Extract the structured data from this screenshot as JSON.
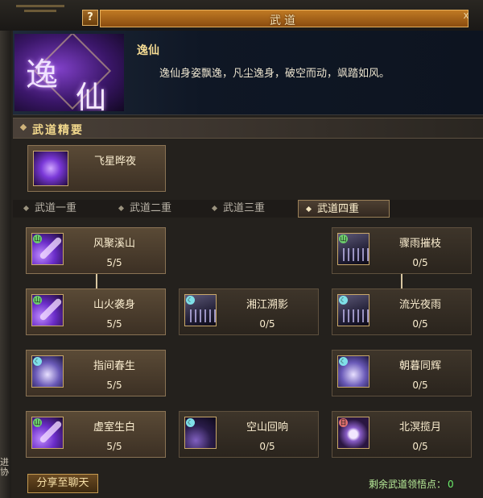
{
  "window": {
    "title": "武道",
    "help_label": "?",
    "close_label": "x"
  },
  "hero": {
    "emblem_char1": "逸",
    "emblem_char2": "仙",
    "name": "逸仙",
    "description": "逸仙身姿飘逸，凡尘逸身，破空而动，飒踏如风。"
  },
  "section": {
    "title": "武道精要"
  },
  "core_skill": {
    "name": "飞星晔夜"
  },
  "tabs": [
    {
      "label": "武道一重"
    },
    {
      "label": "武道二重"
    },
    {
      "label": "武道三重"
    },
    {
      "label": "武道四重",
      "active": true
    }
  ],
  "skills": [
    {
      "name": "风聚溪山",
      "count": "5/5",
      "icon": "purple-swipe-icon"
    },
    {
      "name": "山火袭身",
      "count": "5/5",
      "icon": "purple-swipe-icon"
    },
    {
      "name": "湘江溯影",
      "count": "0/5",
      "icon": "silver-streak-icon"
    },
    {
      "name": "流光夜雨",
      "count": "0/5",
      "icon": "silver-streak-icon"
    },
    {
      "name": "骤雨摧枝",
      "count": "0/5",
      "icon": "silver-streak-icon"
    },
    {
      "name": "指间春生",
      "count": "5/5",
      "icon": "blue-orb-icon"
    },
    {
      "name": "朝暮同辉",
      "count": "0/5",
      "icon": "pale-figure-icon"
    },
    {
      "name": "虚室生白",
      "count": "5/5",
      "icon": "purple-swipe-icon"
    },
    {
      "name": "空山回响",
      "count": "0/5",
      "icon": "dark-swipe-icon"
    },
    {
      "name": "北溟揽月",
      "count": "0/5",
      "icon": "moon-ring-icon"
    }
  ],
  "footer": {
    "share_label": "分享至聊天",
    "points_label": "剩余武道领悟点：",
    "points_value": "0"
  },
  "side_fragment": "进\n协",
  "colors": {
    "accent": "#f3d98d",
    "points": "#6cf06c"
  }
}
